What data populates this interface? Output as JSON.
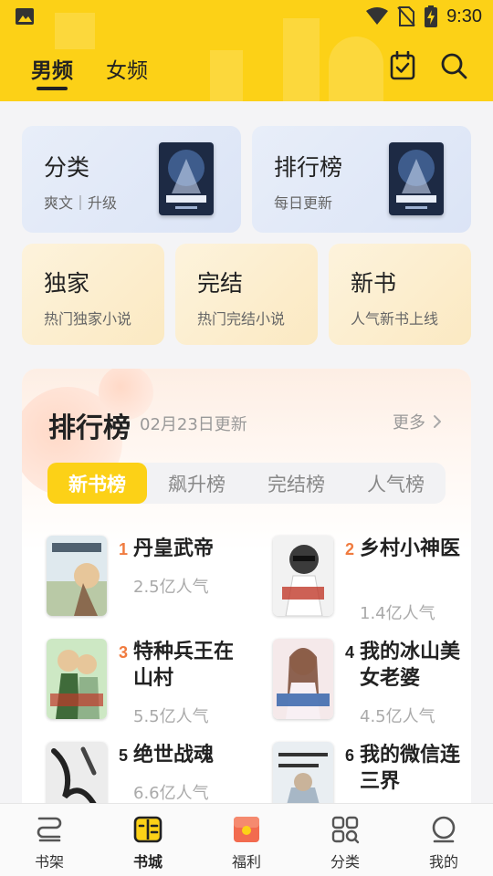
{
  "status_bar": {
    "time": "9:30"
  },
  "header": {
    "tabs": [
      {
        "label": "男频",
        "active": true
      },
      {
        "label": "女频",
        "active": false
      }
    ]
  },
  "quick_cards": {
    "big": [
      {
        "title": "分类",
        "subtitle": "爽文｜升级"
      },
      {
        "title": "排行榜",
        "subtitle": "每日更新"
      }
    ],
    "small": [
      {
        "title": "独家",
        "subtitle": "热门独家小说"
      },
      {
        "title": "完结",
        "subtitle": "热门完结小说"
      },
      {
        "title": "新书",
        "subtitle": "人气新书上线"
      }
    ]
  },
  "ranking": {
    "title": "排行榜",
    "update": "02月23日更新",
    "more": "更多",
    "tabs": [
      "新书榜",
      "飙升榜",
      "完结榜",
      "人气榜"
    ],
    "active_tab": 0,
    "items": [
      {
        "rank": "1",
        "name": "丹皇武帝",
        "popularity": "2.5亿人气"
      },
      {
        "rank": "2",
        "name": "乡村小神医",
        "popularity": "1.4亿人气"
      },
      {
        "rank": "3",
        "name": "特种兵王在山村",
        "popularity": "5.5亿人气"
      },
      {
        "rank": "4",
        "name": "我的冰山美女老婆",
        "popularity": "4.5亿人气"
      },
      {
        "rank": "5",
        "name": "绝世战魂",
        "popularity": "6.6亿人气"
      },
      {
        "rank": "6",
        "name": "我的微信连三界",
        "popularity": ""
      }
    ],
    "colors": {
      "top3": "#f07b3f",
      "other": "#222222"
    }
  },
  "bottom_nav": [
    {
      "label": "书架",
      "icon": "bookshelf-icon",
      "active": false
    },
    {
      "label": "书城",
      "icon": "bookstore-icon",
      "active": true
    },
    {
      "label": "福利",
      "icon": "gift-icon",
      "active": false
    },
    {
      "label": "分类",
      "icon": "category-icon",
      "active": false
    },
    {
      "label": "我的",
      "icon": "profile-icon",
      "active": false
    }
  ],
  "colors": {
    "brand": "#fcd117",
    "rank_hot": "#f07b3f"
  }
}
